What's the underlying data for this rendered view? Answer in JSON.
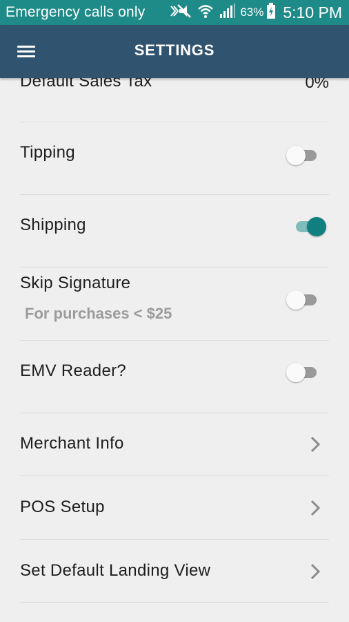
{
  "status_bar": {
    "carrier_text": "Emergency calls only",
    "battery_percent": "63%",
    "time": "5:10 PM",
    "icons": [
      "mute-icon",
      "wifi-icon",
      "signal-icon",
      "battery-icon"
    ]
  },
  "app_bar": {
    "title": "SETTINGS",
    "menu_icon": "hamburger-menu-icon"
  },
  "settings": {
    "default_sales_tax": {
      "label": "Default Sales Tax",
      "value": "0%"
    },
    "tipping": {
      "label": "Tipping",
      "enabled": false
    },
    "shipping": {
      "label": "Shipping",
      "enabled": true
    },
    "skip_signature": {
      "label": "Skip Signature",
      "sublabel": "For purchases < $25",
      "enabled": false
    },
    "emv_reader": {
      "label": "EMV Reader?",
      "enabled": false
    },
    "merchant_info": {
      "label": "Merchant Info",
      "icon": "chevron-right-icon"
    },
    "pos_setup": {
      "label": "POS Setup",
      "icon": "chevron-right-icon"
    },
    "default_landing_view": {
      "label": "Set Default Landing View",
      "icon": "chevron-right-icon"
    }
  },
  "colors": {
    "status_bar": "#1f8b88",
    "app_bar": "#30546f",
    "background": "#efefef",
    "toggle_on": "#0f7f80",
    "toggle_off": "#9a9a9a"
  }
}
